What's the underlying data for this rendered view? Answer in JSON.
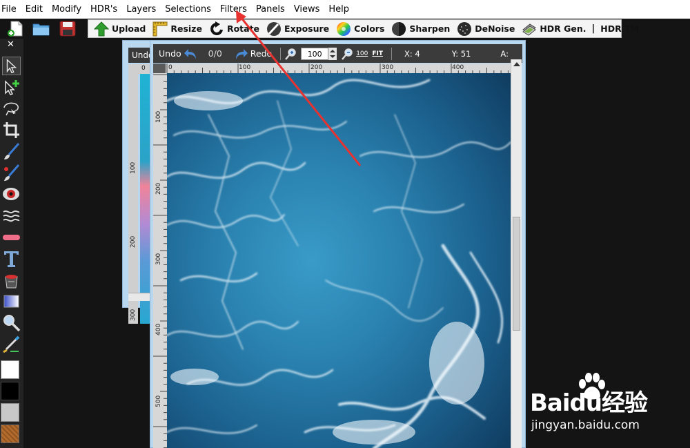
{
  "menubar": {
    "items": [
      {
        "label": "File"
      },
      {
        "label": "Edit"
      },
      {
        "label": "Modify"
      },
      {
        "label": "HDR's"
      },
      {
        "label": "Layers"
      },
      {
        "label": "Selections"
      },
      {
        "label": "Filters"
      },
      {
        "label": "Panels"
      },
      {
        "label": "Views"
      },
      {
        "label": "Help"
      }
    ]
  },
  "toolbar": {
    "file_icons": [
      "new-file-icon",
      "open-folder-icon",
      "save-disk-icon"
    ],
    "buttons": [
      {
        "label": "Upload",
        "icon": "upload-arrow-icon",
        "color": "#2e9d2e"
      },
      {
        "label": "Resize",
        "icon": "ruler-square-icon",
        "color": "#c9a21e"
      },
      {
        "label": "Rotate",
        "icon": "rotate-arrow-icon",
        "color": "#222222"
      },
      {
        "label": "Exposure",
        "icon": "exposure-brush-icon",
        "color": "#333333"
      },
      {
        "label": "Colors",
        "icon": "color-wheel-icon",
        "color": "#e23c9c"
      },
      {
        "label": "Sharpen",
        "icon": "sharpen-sphere-icon",
        "color": "#444444"
      },
      {
        "label": "DeNoise",
        "icon": "denoise-sphere-icon",
        "color": "#333333"
      },
      {
        "label": "HDR Gen.",
        "icon": "hdr-stack-icon",
        "color": "#777777"
      }
    ],
    "separator": "|",
    "hdr_tm_label": "HDR TM"
  },
  "left_panel": {
    "close_glyph": "✕",
    "tools": [
      "pointer-icon",
      "add-selection-icon",
      "lasso-icon",
      "crop-icon",
      "brush-icon",
      "red-brush-icon",
      "red-eye-icon",
      "smudge-waves-icon",
      "eraser-icon",
      "text-tool-icon",
      "paint-bucket-icon",
      "gradient-icon",
      "zoom-tool-icon",
      "eyedropper-icon"
    ],
    "swatches": {
      "foreground": "#ffffff",
      "background": "#000000",
      "third": "#c8c8c8",
      "texture": "#b36a2b"
    }
  },
  "layer_panel": {
    "title": "Undo",
    "ruler_top": "0",
    "ruler_left": [
      "100",
      "200",
      "300"
    ]
  },
  "image_window": {
    "undo_label": "Undo",
    "history": "0/0",
    "redo_label": "Redo",
    "zoom": "100",
    "zoom_100_label": "100",
    "fit_label": "FIT",
    "x_label": "X: 4",
    "y_label": "Y: 51",
    "a_label": "A:",
    "ruler_top": [
      "0",
      "100",
      "200",
      "300",
      "400"
    ],
    "ruler_left": [
      "100",
      "200",
      "300",
      "400",
      "500"
    ]
  },
  "watermark": {
    "brand": "Baidu经验",
    "url": "jingyan.baidu.com"
  }
}
